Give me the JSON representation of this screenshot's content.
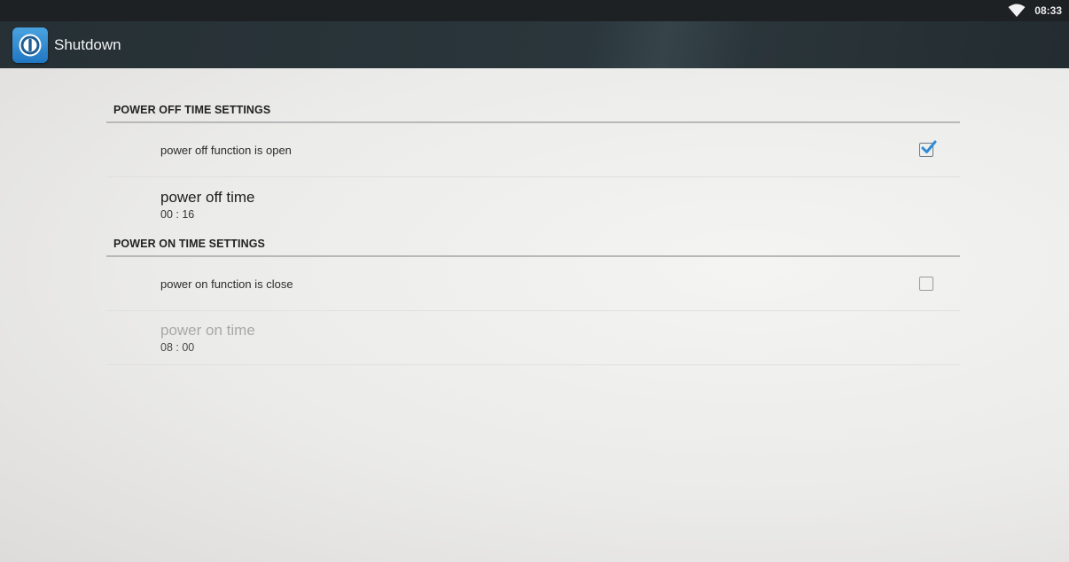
{
  "status_bar": {
    "time": "08:33",
    "wifi_icon": "wifi-icon"
  },
  "app": {
    "title": "Shutdown",
    "icon": "power-icon",
    "accent": "#2f8bd6"
  },
  "sections": {
    "power_off": {
      "header": "POWER OFF TIME SETTINGS",
      "toggle_label": "power off function is open",
      "toggle_checked": true,
      "time_title": "power off time",
      "time_value": "00 : 16"
    },
    "power_on": {
      "header": "POWER ON TIME SETTINGS",
      "toggle_label": "power on function is close",
      "toggle_checked": false,
      "time_title": "power on time",
      "time_value": "08 : 00"
    }
  }
}
